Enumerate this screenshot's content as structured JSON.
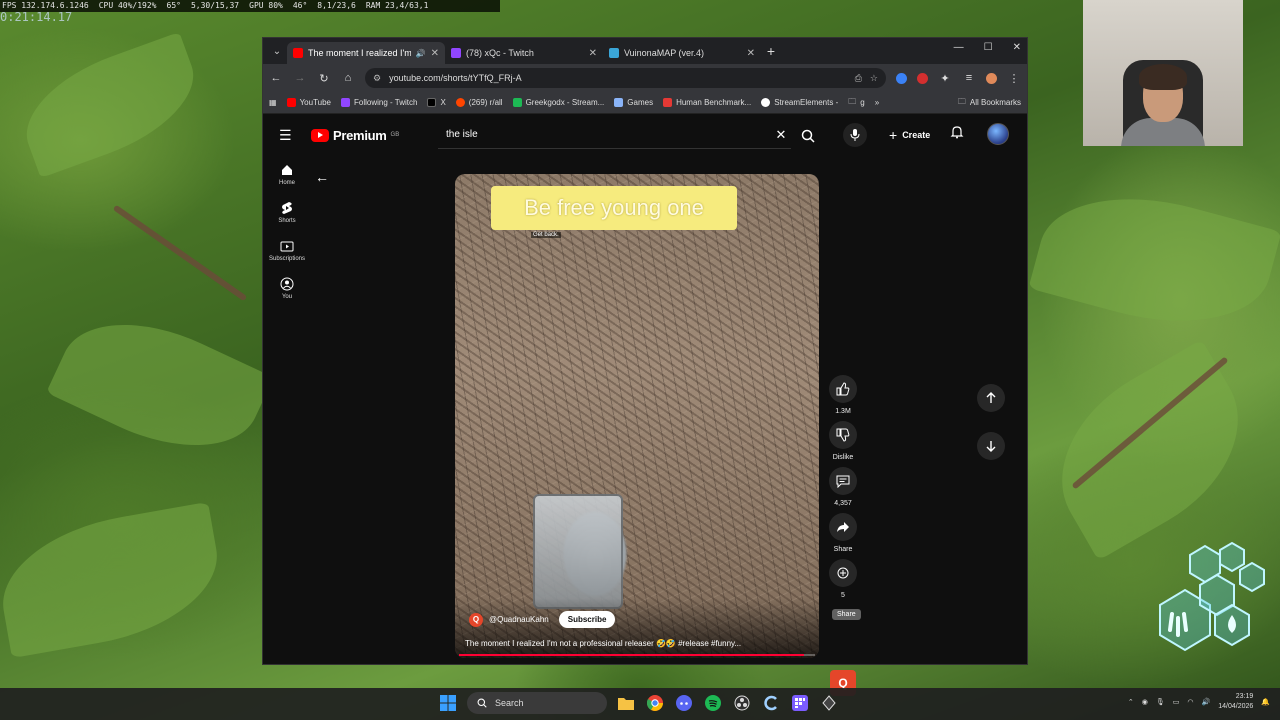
{
  "hud": {
    "fps": "FPS 132.174.6.1246",
    "cpu": "CPU 40%/192%",
    "gpu_temp": "65°",
    "gpu_clock": "5,30/15,37",
    "gpu": "GPU 80%",
    "gpu_temp2": "46°",
    "vram": "8,1/23,6",
    "ram": "RAM 23,4/63,1",
    "clock": "0:21:14.17"
  },
  "browser": {
    "tabs": [
      {
        "title": "The moment I realized I'm n",
        "favicon_color": "#ff0000",
        "active": true
      },
      {
        "title": "(78) xQc - Twitch",
        "favicon_color": "#9146ff",
        "active": false
      },
      {
        "title": "VuinonaMAP (ver.4)",
        "favicon_color": "#3aa6d8",
        "active": false
      }
    ],
    "url": "youtube.com/shorts/tYTfQ_FRj-A",
    "bookmarks": [
      {
        "label": "YouTube",
        "color": "#ff0000"
      },
      {
        "label": "Following - Twitch",
        "color": "#9146ff"
      },
      {
        "label": "X",
        "color": "#000000"
      },
      {
        "label": "(269) r/all",
        "color": "#ff4500"
      },
      {
        "label": "Greekgodx - Stream...",
        "color": "#1db954"
      },
      {
        "label": "Games",
        "color": "#8ab4f8"
      },
      {
        "label": "Human Benchmark...",
        "color": "#e53935"
      },
      {
        "label": "StreamElements -",
        "color": "#ffffff"
      },
      {
        "label": "g",
        "color": "#8ab4f8"
      }
    ],
    "all_bookmarks": "All Bookmarks"
  },
  "youtube": {
    "logo": "Premium",
    "logo_region": "GB",
    "search_query": "the isle",
    "create_label": "Create",
    "sidebar": [
      {
        "label": "Home",
        "icon": "home-icon"
      },
      {
        "label": "Shorts",
        "icon": "shorts-icon"
      },
      {
        "label": "Subscriptions",
        "icon": "subscriptions-icon"
      },
      {
        "label": "You",
        "icon": "you-icon"
      }
    ],
    "short": {
      "caption": "Be free young one",
      "sub_caption": "Get back.",
      "channel_initial": "Q",
      "channel": "@QuadnauKahn",
      "subscribe_label": "Subscribe",
      "title": "The moment I realized I'm not a professional releaser 🤣🤣 #release #funny...",
      "progress": 0.97
    },
    "actions": {
      "likes": "1.3M",
      "dislike": "Dislike",
      "comments": "4,357",
      "share": "Share",
      "remix": "5",
      "tooltip": "Share"
    }
  },
  "taskbar": {
    "search_label": "Search",
    "time": "23:19",
    "date": "14/04/2026"
  }
}
